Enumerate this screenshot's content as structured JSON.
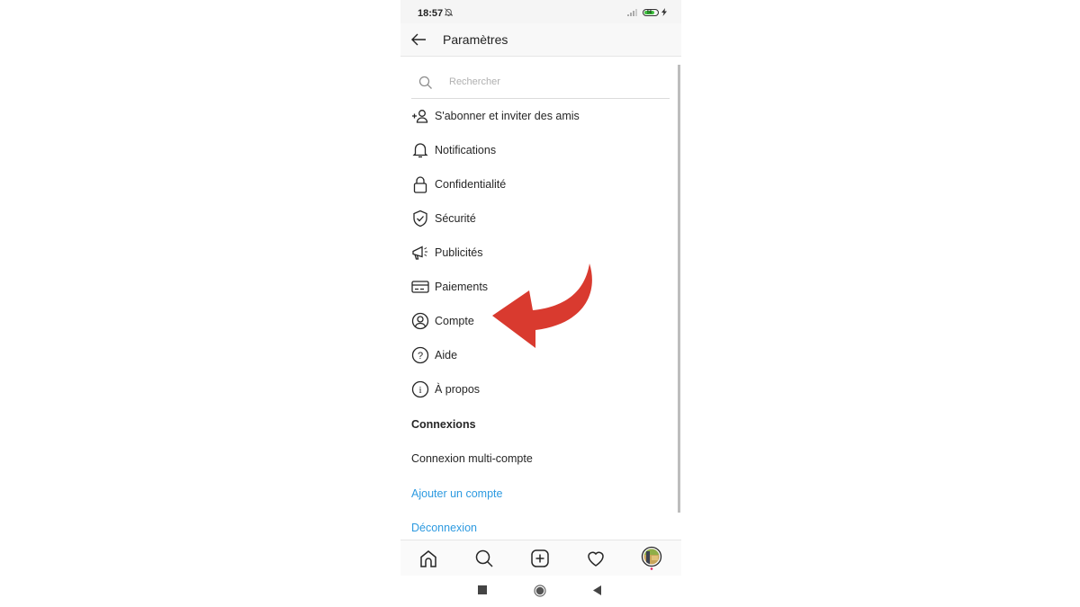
{
  "status_bar": {
    "time": "18:57",
    "bell_icon": "bell-off-icon",
    "signal_icon": "signal-icon",
    "battery_level": "56",
    "charging_icon": "bolt-icon"
  },
  "header": {
    "back_icon": "arrow-left-icon",
    "title": "Paramètres"
  },
  "search": {
    "placeholder": "Rechercher",
    "value": ""
  },
  "menu_items": [
    {
      "label": "S'abonner et inviter des amis",
      "icon": "add-person-icon"
    },
    {
      "label": "Notifications",
      "icon": "bell-icon"
    },
    {
      "label": "Confidentialité",
      "icon": "lock-icon"
    },
    {
      "label": "Sécurité",
      "icon": "shield-check-icon"
    },
    {
      "label": "Publicités",
      "icon": "megaphone-icon"
    },
    {
      "label": "Paiements",
      "icon": "credit-card-icon"
    },
    {
      "label": "Compte",
      "icon": "user-circle-icon"
    },
    {
      "label": "Aide",
      "icon": "help-circle-icon"
    },
    {
      "label": "À propos",
      "icon": "info-circle-icon"
    }
  ],
  "connexions": {
    "heading": "Connexions",
    "multi_account": "Connexion multi-compte",
    "add_account": "Ajouter un compte",
    "logout": "Déconnexion"
  },
  "bottom_tabs": [
    "home-icon",
    "search-icon",
    "add-post-icon",
    "heart-icon",
    "profile-avatar"
  ],
  "android_nav": [
    "recents-icon",
    "home-circle-icon",
    "back-triangle-icon"
  ],
  "colors": {
    "link": "#2d9ae0",
    "annotation_arrow": "#d93a2f",
    "text": "#262626"
  }
}
